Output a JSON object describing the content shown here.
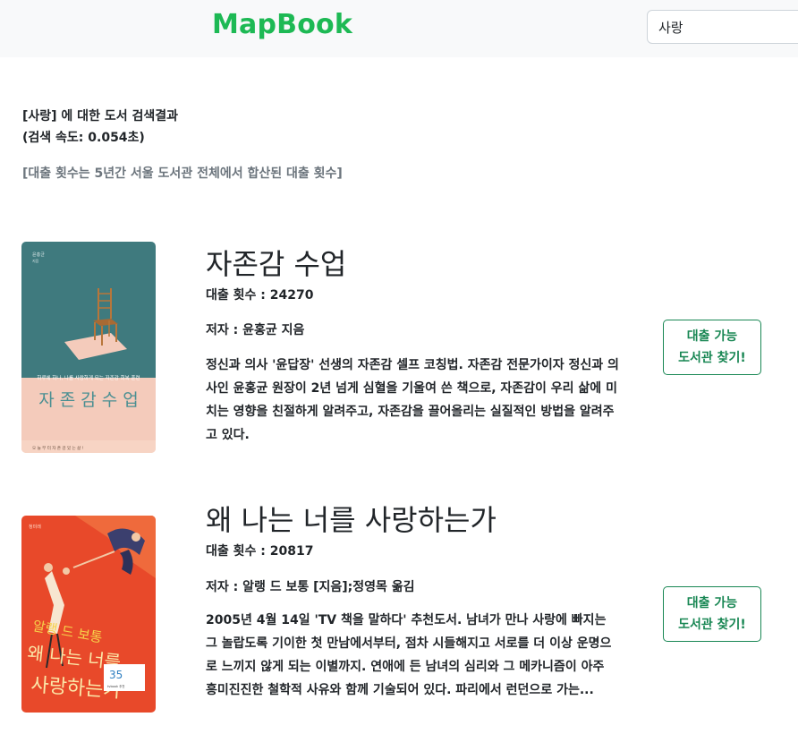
{
  "navbar": {
    "brand": "MapBook",
    "search_value": "사랑"
  },
  "summary": {
    "line1": "[사랑] 에 대한 도서 검색결과",
    "line2": "(검색 속도: 0.054초)",
    "note": "[대출 횟수는 5년간 서울 도서관 전체에서 합산된 대출 횟수]"
  },
  "books": [
    {
      "title": "자존감 수업",
      "loans": "대출 횟수 : 24270",
      "author": "저자 : 윤홍균 지음",
      "description": "정신과 의사 '윤답장' 선생의 자존감 셀프 코칭법. 자존감 전문가이자 정신과 의사인 윤홍균 원장이 2년 넘게 심혈을 기울여 쓴 책으로, 자존감이 우리 삶에 미치는 영향을 친절하게 알려주고, 자존감을 끌어올리는 실질적인 방법을 알려주고 있다.",
      "button_line1": "대출 가능",
      "button_line2": "도서관 찾기!",
      "cover_title": "자 존 감  수 업"
    },
    {
      "title": "왜 나는 너를 사랑하는가",
      "loans": "대출 횟수 : 20817",
      "author": "저자 : 알랭 드 보통 [지음];정영목 옮김",
      "description": "2005년 4월 14일 'TV 책을 말하다' 추천도서. 남녀가 만나 사랑에 빠지는 그 놀랍도록 기이한 첫 만남에서부터, 점차 시들해지고 서로를 더 이상 운명으로 느끼지 않게 되는 이별까지. 연애에 든 남녀의 심리와 그 메카니즘이 아주 흥미진진한 철학적 사유와 함께 기술되어 있다. 파리에서 런던으로 가는...",
      "button_line1": "대출 가능",
      "button_line2": "도서관 찾기!"
    }
  ],
  "colors": {
    "brand": "#1db954",
    "button": "#198754",
    "note": "#6c757d"
  }
}
